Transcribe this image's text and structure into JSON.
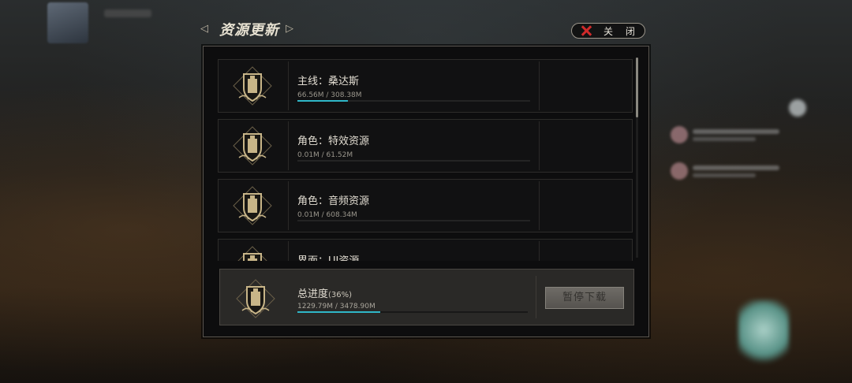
{
  "header": {
    "title": "资源更新",
    "close_label": "关 闭"
  },
  "downloads": [
    {
      "name": "主线：桑达斯",
      "size": "66.56M / 308.38M",
      "progress": 0.216
    },
    {
      "name": "角色：特效资源",
      "size": "0.01M / 61.52M",
      "progress": 0.0
    },
    {
      "name": "角色：音频资源",
      "size": "0.01M / 608.34M",
      "progress": 0.0
    },
    {
      "name": "界面：UI资源",
      "size": "",
      "progress": 0.0
    }
  ],
  "total": {
    "label": "总进度",
    "percent": "(36%)",
    "size": "1229.79M / 3478.90M",
    "progress": 0.36,
    "pause_label": "暂停下载"
  },
  "colors": {
    "accent": "#2fb7c8",
    "close_x": "#d02a2a",
    "emblem_gold": "#c8b588"
  },
  "icons": [
    "arrow-left-icon",
    "arrow-right-icon",
    "close-icon",
    "emblem-icon"
  ]
}
